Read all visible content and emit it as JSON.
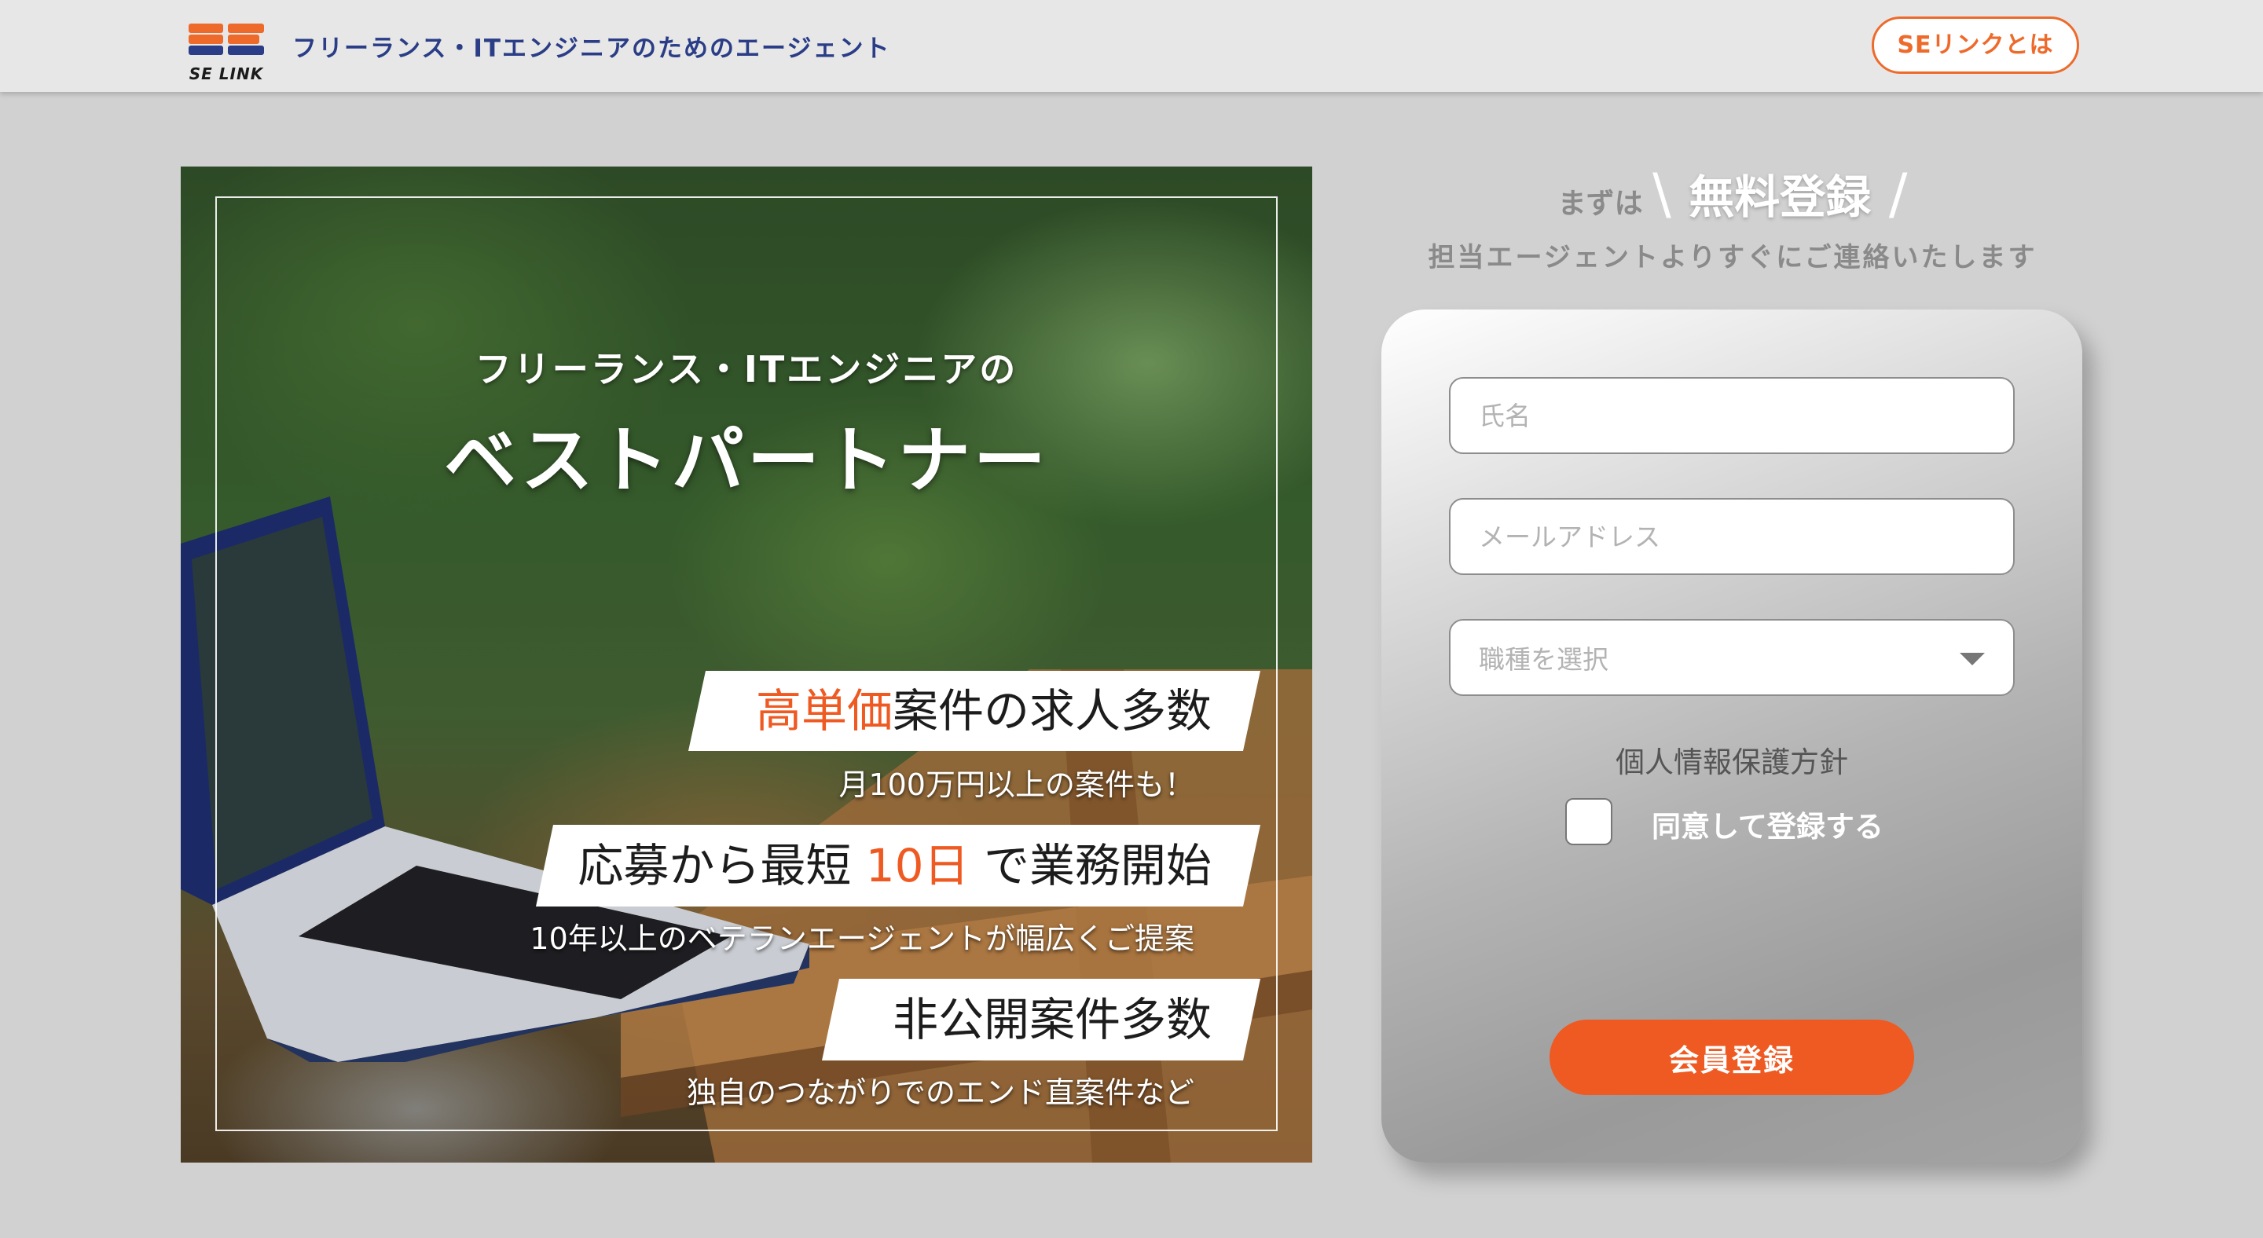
{
  "header": {
    "logo_mark": "SE",
    "logo_text": "SE LINK",
    "tagline": "フリーランス・ITエンジニアのためのエージェント",
    "about_button": "SEリンクとは"
  },
  "hero": {
    "subtitle": "フリーランス・ITエンジニアの",
    "title": "ベストパートナー",
    "features": [
      {
        "highlight": "高単価",
        "text": "案件の求人多数",
        "note": "月100万円以上の案件も！"
      },
      {
        "prefix": "応募から最短 ",
        "highlight": "10日",
        "suffix": " で業務開始",
        "note": "10年以上のベテランエージェントが幅広くご提案"
      },
      {
        "text": "非公開案件多数",
        "note": "独自のつながりでのエンド直案件など"
      }
    ]
  },
  "registration": {
    "lead": "まずは",
    "headline": "無料登録",
    "description": "担当エージェントよりすぐにご連絡いたします",
    "name_placeholder": "氏名",
    "email_placeholder": "メールアドレス",
    "job_select": "職種を選択",
    "privacy_policy": "個人情報保護方針",
    "agree_label": "同意して登録する",
    "submit_label": "会員登録"
  },
  "colors": {
    "accent": "#ee5a22",
    "brand_navy": "#2a3d86",
    "background": "#d1d1d1"
  }
}
